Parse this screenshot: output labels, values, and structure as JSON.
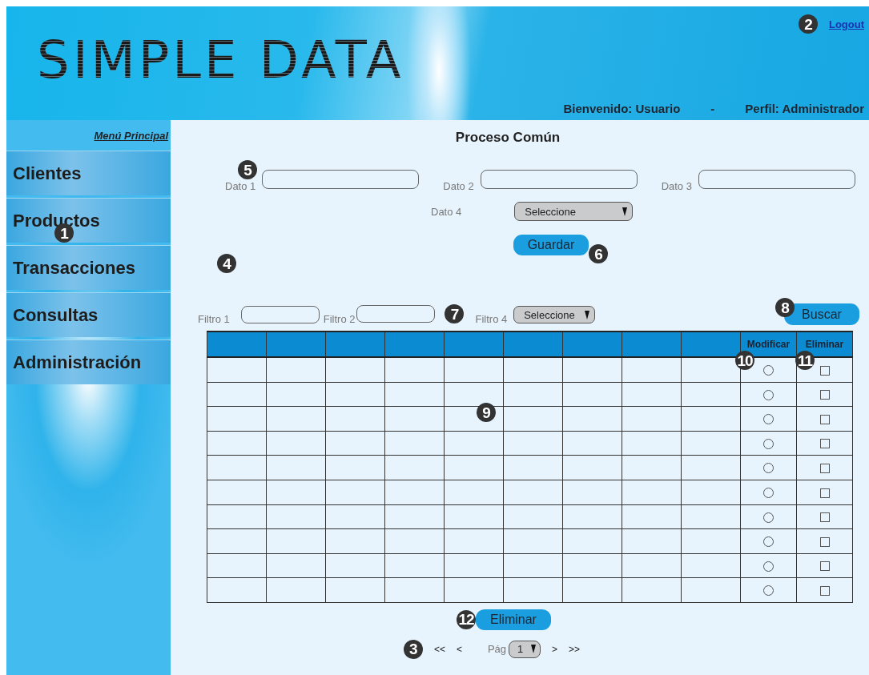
{
  "header": {
    "logo": "SIMPLE DATA",
    "logout": "Logout",
    "logout_callout": "2",
    "welcome": "Bienvenido: Usuario",
    "separator": "-",
    "profile": "Perfil: Administrador"
  },
  "sidebar": {
    "title": "Menú Principal",
    "callout": "1",
    "items": [
      {
        "label": "Clientes"
      },
      {
        "label": "Productos"
      },
      {
        "label": "Transacciones"
      },
      {
        "label": "Consultas"
      },
      {
        "label": "Administración"
      }
    ]
  },
  "main": {
    "title": "Proceso Común",
    "callout": "4",
    "form": {
      "callout": "5",
      "fields": [
        {
          "label": "Dato 1",
          "kind": "text"
        },
        {
          "label": "Dato 2",
          "kind": "text"
        },
        {
          "label": "Dato 3",
          "kind": "text"
        },
        {
          "label": "Dato 4",
          "kind": "select",
          "value": "Seleccione"
        }
      ],
      "save_button": "Guardar",
      "save_callout": "6"
    },
    "filters": {
      "callout": "7",
      "fields": [
        {
          "label": "Filtro 1",
          "kind": "text"
        },
        {
          "label": "Filtro 2",
          "kind": "text"
        },
        {
          "label": "Filtro 4",
          "kind": "select",
          "value": "Seleccione"
        }
      ],
      "search_button": "Buscar",
      "search_callout": "8"
    },
    "table": {
      "callout": "9",
      "columns": [
        {
          "label": "Modificar",
          "callout": "10"
        },
        {
          "label": "Eliminar",
          "callout": "11"
        }
      ],
      "rows": [
        {
          "selected": false,
          "checked": false
        },
        {
          "selected": false,
          "checked": false
        },
        {
          "selected": false,
          "checked": false
        },
        {
          "selected": false,
          "checked": false
        },
        {
          "selected": false,
          "checked": false
        },
        {
          "selected": false,
          "checked": false
        },
        {
          "selected": false,
          "checked": false
        },
        {
          "selected": false,
          "checked": false
        },
        {
          "selected": false,
          "checked": false
        },
        {
          "selected": false,
          "checked": false
        }
      ]
    },
    "delete_button": "Eliminar",
    "delete_callout": "12",
    "pager": {
      "callout": "3",
      "first": "<<",
      "prev": "<",
      "label": "Pág",
      "page": "1",
      "next": ">",
      "last": ">>"
    }
  }
}
